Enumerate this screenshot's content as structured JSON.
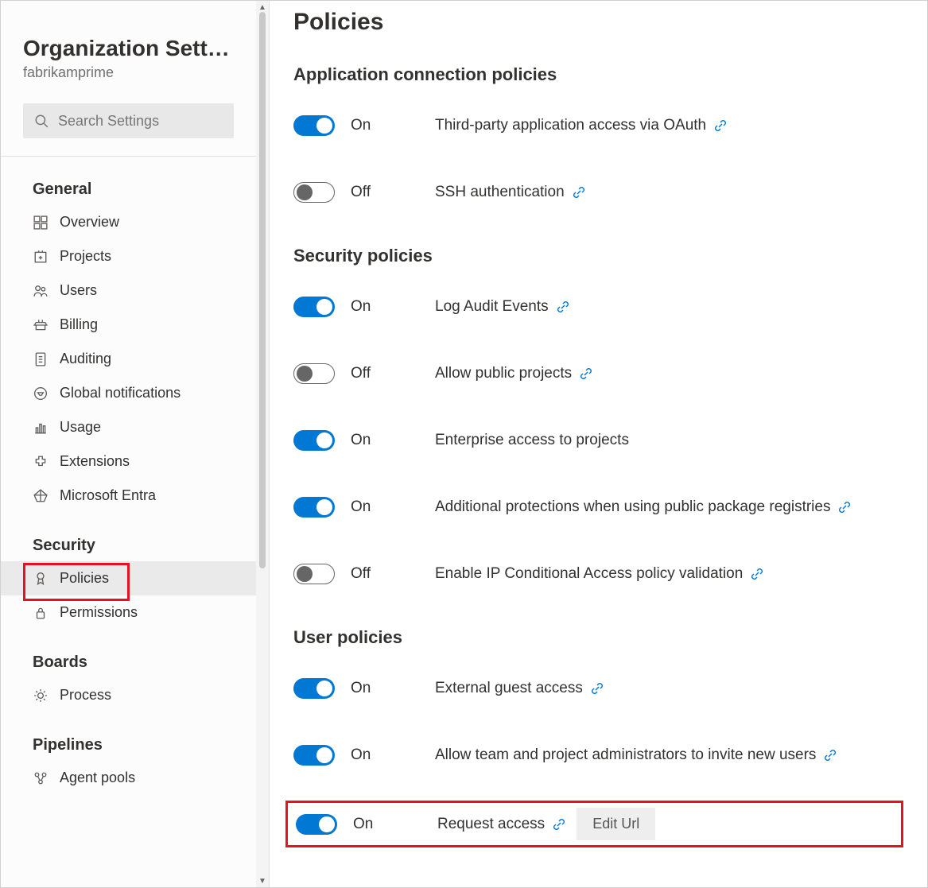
{
  "sidebar": {
    "title": "Organization Settin…",
    "subtitle": "fabrikamprime",
    "search_placeholder": "Search Settings",
    "sections": [
      {
        "label": "General",
        "items": [
          {
            "icon": "overview-icon",
            "label": "Overview"
          },
          {
            "icon": "projects-icon",
            "label": "Projects"
          },
          {
            "icon": "users-icon",
            "label": "Users"
          },
          {
            "icon": "billing-icon",
            "label": "Billing"
          },
          {
            "icon": "auditing-icon",
            "label": "Auditing"
          },
          {
            "icon": "notifications-icon",
            "label": "Global notifications"
          },
          {
            "icon": "usage-icon",
            "label": "Usage"
          },
          {
            "icon": "extensions-icon",
            "label": "Extensions"
          },
          {
            "icon": "entra-icon",
            "label": "Microsoft Entra"
          }
        ]
      },
      {
        "label": "Security",
        "items": [
          {
            "icon": "policies-icon",
            "label": "Policies",
            "active": true,
            "highlight": true
          },
          {
            "icon": "permissions-icon",
            "label": "Permissions"
          }
        ]
      },
      {
        "label": "Boards",
        "items": [
          {
            "icon": "process-icon",
            "label": "Process"
          }
        ]
      },
      {
        "label": "Pipelines",
        "items": [
          {
            "icon": "agent-pools-icon",
            "label": "Agent pools"
          }
        ]
      }
    ]
  },
  "main": {
    "title": "Policies",
    "labels": {
      "on": "On",
      "off": "Off"
    },
    "edit_url_label": "Edit Url",
    "groups": [
      {
        "title": "Application connection policies",
        "policies": [
          {
            "on": true,
            "label": "Third-party application access via OAuth",
            "link": true
          },
          {
            "on": false,
            "label": "SSH authentication",
            "link": true
          }
        ]
      },
      {
        "title": "Security policies",
        "policies": [
          {
            "on": true,
            "label": "Log Audit Events",
            "link": true
          },
          {
            "on": false,
            "label": "Allow public projects",
            "link": true
          },
          {
            "on": true,
            "label": "Enterprise access to projects",
            "link": false
          },
          {
            "on": true,
            "label": "Additional protections when using public package registries",
            "link": true
          },
          {
            "on": false,
            "label": "Enable IP Conditional Access policy validation",
            "link": true
          }
        ]
      },
      {
        "title": "User policies",
        "policies": [
          {
            "on": true,
            "label": "External guest access",
            "link": true
          },
          {
            "on": true,
            "label": "Allow team and project administrators to invite new users",
            "link": true
          },
          {
            "on": true,
            "label": "Request access",
            "link": true,
            "edit_url": true,
            "highlight": true
          }
        ]
      }
    ]
  }
}
